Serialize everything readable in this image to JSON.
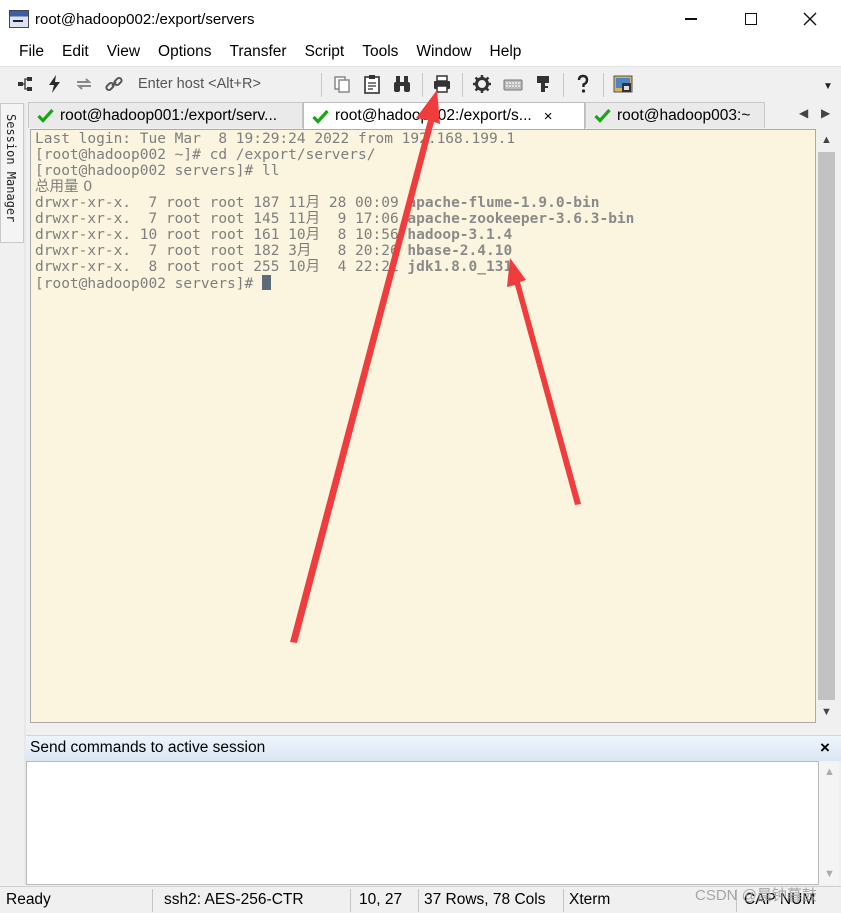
{
  "window": {
    "title": "root@hadoop002:/export/servers"
  },
  "menu": [
    "File",
    "Edit",
    "View",
    "Options",
    "Transfer",
    "Script",
    "Tools",
    "Window",
    "Help"
  ],
  "toolbar": {
    "host_placeholder": "Enter host <Alt+R>",
    "icons": [
      "connect-tree-icon",
      "lightning-icon",
      "reconnect-icon",
      "link-icon",
      "copy-icon",
      "paste-icon",
      "binoculars-icon",
      "printer-icon",
      "gear-icon",
      "keyboard-icon",
      "key-icon",
      "help-icon",
      "sftp-icon"
    ]
  },
  "session_manager": {
    "label": "Session Manager"
  },
  "tabs": [
    {
      "label": "root@hadoop001:/export/serv...",
      "status": "connected",
      "active": false
    },
    {
      "label": "root@hadoop002:/export/s...",
      "status": "connected",
      "active": true,
      "close": "×"
    },
    {
      "label": "root@hadoop003:~",
      "status": "connected",
      "active": false
    }
  ],
  "terminal": {
    "lines": [
      {
        "text": "Last login: Tue Mar  8 19:29:24 2022 from 192.168.199.1"
      },
      {
        "text": "[root@hadoop002 ~]# cd /export/servers/"
      },
      {
        "text": "[root@hadoop002 servers]# ll"
      },
      {
        "text": "总用量 0"
      },
      {
        "text": "drwxr-xr-x.  7 root root 187 11月 28 00:09 ",
        "bold": "apache-flume-1.9.0-bin"
      },
      {
        "text": "drwxr-xr-x.  7 root root 145 11月  9 17:06 ",
        "bold": "apache-zookeeper-3.6.3-bin"
      },
      {
        "text": "drwxr-xr-x. 10 root root 161 10月  8 10:56 ",
        "bold": "hadoop-3.1.4"
      },
      {
        "text": "drwxr-xr-x.  7 root root 182 3月   8 20:26 ",
        "bold": "hbase-2.4.10"
      },
      {
        "text": "drwxr-xr-x.  8 root root 255 10月  4 22:21 ",
        "bold": "jdk1.8.0_131"
      }
    ],
    "prompt": "[root@hadoop002 servers]# "
  },
  "command_window": {
    "title": "Send commands to active session",
    "close": "×"
  },
  "status": {
    "ready": "Ready",
    "cipher": "ssh2: AES-256-CTR",
    "cursor_pos": "10,  27",
    "size": "37 Rows, 78 Cols",
    "emulation": "Xterm",
    "keys": "CAP NUM"
  },
  "watermark": "CSDN @晨钟暮鼓",
  "colors": {
    "terminal_bg": "#fbf4df",
    "terminal_text": "#7e7e7e",
    "annotation_arrow": "#f03c3c",
    "check_green": "#19a619"
  }
}
